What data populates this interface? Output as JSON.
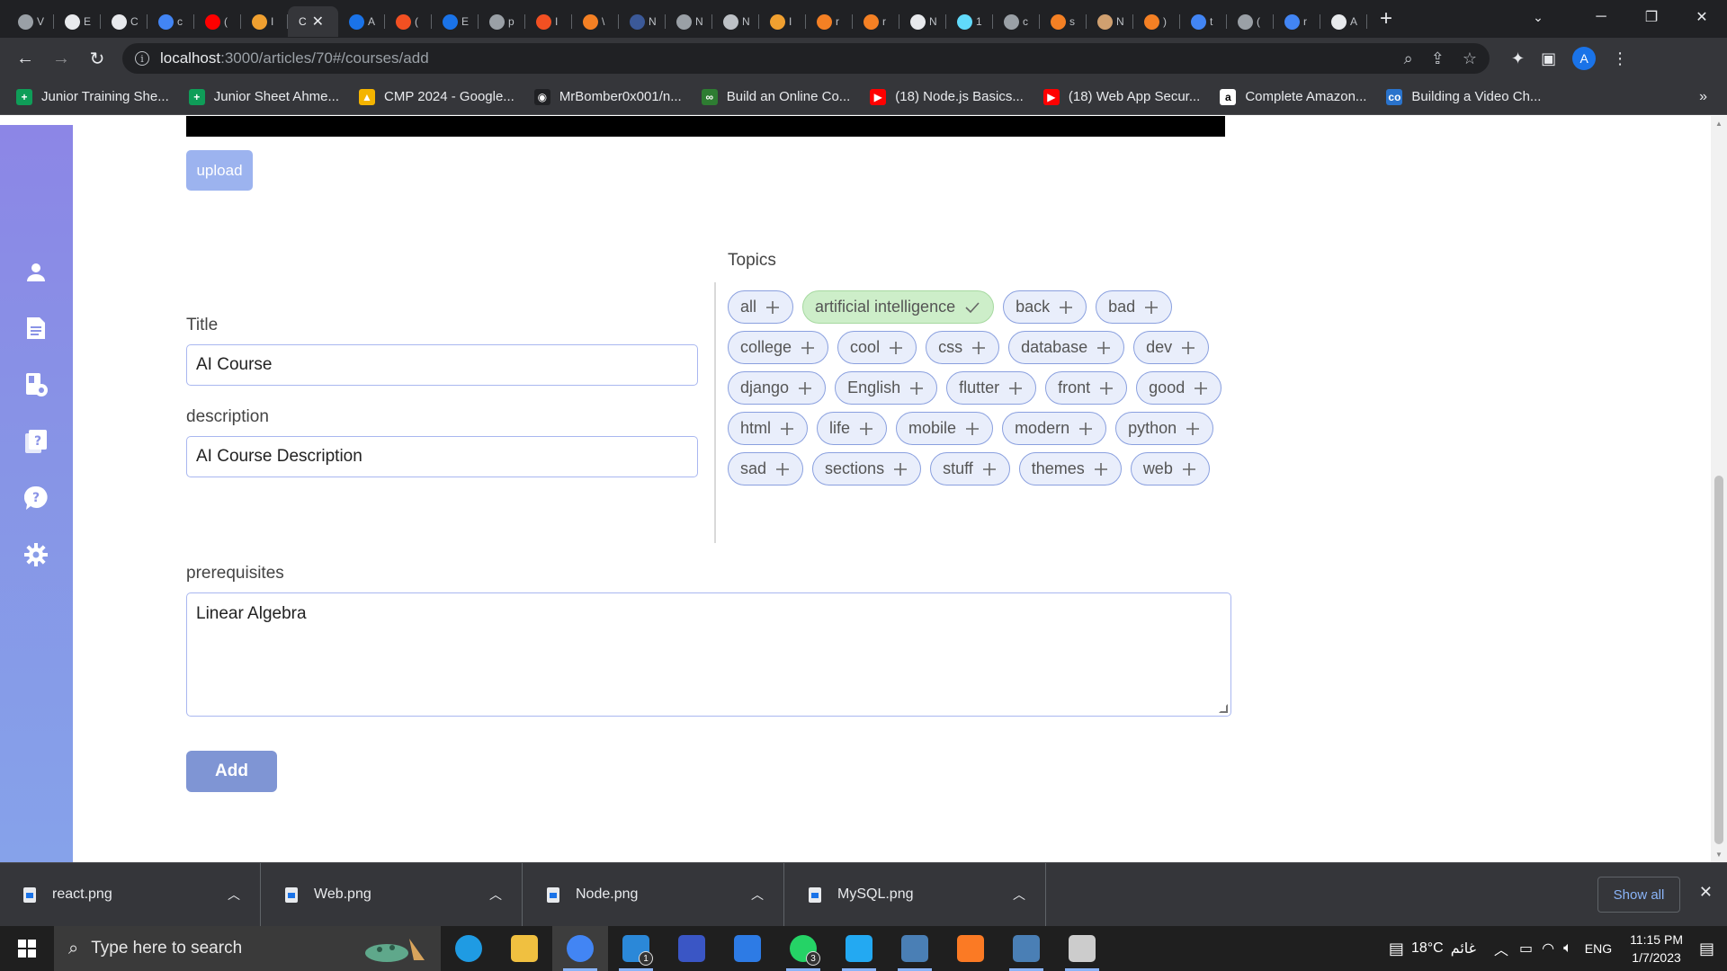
{
  "browser": {
    "tabs": [
      {
        "letter": "V",
        "color": "#9aa0a6"
      },
      {
        "letter": "E",
        "color": "#e8eaed"
      },
      {
        "letter": "C",
        "color": "#e8eaed"
      },
      {
        "letter": "c",
        "color": "#4285f4"
      },
      {
        "letter": "(",
        "color": "#ff0000"
      },
      {
        "letter": "I",
        "color": "#f0a030"
      },
      {
        "letter": "A",
        "color": "#1a73e8"
      },
      {
        "letter": "(",
        "color": "#f25022"
      },
      {
        "letter": "E",
        "color": "#1a73e8"
      },
      {
        "letter": "p",
        "color": "#9aa0a6"
      },
      {
        "letter": "I",
        "color": "#f25022"
      },
      {
        "letter": "\\",
        "color": "#f48024"
      },
      {
        "letter": "N",
        "color": "#3b5998"
      },
      {
        "letter": "N",
        "color": "#9aa0a6"
      },
      {
        "letter": "N",
        "color": "#bdc1c6"
      },
      {
        "letter": "I",
        "color": "#f0a030"
      },
      {
        "letter": "r",
        "color": "#f48024"
      },
      {
        "letter": "r",
        "color": "#f48024"
      },
      {
        "letter": "N",
        "color": "#e8eaed"
      },
      {
        "letter": "1",
        "color": "#61dafb"
      },
      {
        "letter": "c",
        "color": "#9aa0a6"
      },
      {
        "letter": "s",
        "color": "#f48024"
      },
      {
        "letter": "N",
        "color": "#d0a070"
      },
      {
        "letter": ")",
        "color": "#f48024"
      },
      {
        "letter": "t",
        "color": "#4285f4"
      },
      {
        "letter": "(",
        "color": "#9aa0a6"
      },
      {
        "letter": "r",
        "color": "#4285f4"
      },
      {
        "letter": "A",
        "color": "#e8eaed"
      }
    ],
    "active_tab": {
      "letter": "C",
      "close": "✕"
    },
    "new_tab_symbol": "+",
    "url": {
      "host": "localhost",
      "path": ":3000/articles/70#/courses/add"
    },
    "profile_initial": "A",
    "bookmarks": [
      {
        "label": "Junior Training She...",
        "icon": "sheets-icon",
        "color": "#0f9d58",
        "glyph": "+"
      },
      {
        "label": "Junior Sheet Ahme...",
        "icon": "sheets-icon",
        "color": "#0f9d58",
        "glyph": "+"
      },
      {
        "label": "CMP 2024 - Google...",
        "icon": "drive-icon",
        "color": "#f4b400",
        "glyph": "▲"
      },
      {
        "label": "MrBomber0x001/n...",
        "icon": "github-icon",
        "color": "#202124",
        "glyph": "◉"
      },
      {
        "label": "Build an Online Co...",
        "icon": "link-icon",
        "color": "#2e7d32",
        "glyph": "∞"
      },
      {
        "label": "(18) Node.js Basics...",
        "icon": "youtube-icon",
        "color": "#ff0000",
        "glyph": "▶"
      },
      {
        "label": "(18) Web App Secur...",
        "icon": "youtube-icon",
        "color": "#ff0000",
        "glyph": "▶"
      },
      {
        "label": "Complete Amazon...",
        "icon": "amazon-icon",
        "color": "#ffffff",
        "glyph": "a"
      },
      {
        "label": "Building a Video Ch...",
        "icon": "coursera-icon",
        "color": "#2a73cc",
        "glyph": "co"
      }
    ],
    "bookmarks_more": "»"
  },
  "page": {
    "upload_label": "upload",
    "title_label": "Title",
    "title_value": "AI Course",
    "description_label": "description",
    "description_value": "AI Course Description",
    "topics_label": "Topics",
    "topics": [
      {
        "name": "all",
        "selected": false
      },
      {
        "name": "artificial intelligence",
        "selected": true
      },
      {
        "name": "back",
        "selected": false
      },
      {
        "name": "bad",
        "selected": false
      },
      {
        "name": "college",
        "selected": false
      },
      {
        "name": "cool",
        "selected": false
      },
      {
        "name": "css",
        "selected": false
      },
      {
        "name": "database",
        "selected": false
      },
      {
        "name": "dev",
        "selected": false
      },
      {
        "name": "django",
        "selected": false
      },
      {
        "name": "English",
        "selected": false
      },
      {
        "name": "flutter",
        "selected": false
      },
      {
        "name": "front",
        "selected": false
      },
      {
        "name": "good",
        "selected": false
      },
      {
        "name": "html",
        "selected": false
      },
      {
        "name": "life",
        "selected": false
      },
      {
        "name": "mobile",
        "selected": false
      },
      {
        "name": "modern",
        "selected": false
      },
      {
        "name": "python",
        "selected": false
      },
      {
        "name": "sad",
        "selected": false
      },
      {
        "name": "sections",
        "selected": false
      },
      {
        "name": "stuff",
        "selected": false
      },
      {
        "name": "themes",
        "selected": false
      },
      {
        "name": "web",
        "selected": false
      }
    ],
    "prerequisites_label": "prerequisites",
    "prerequisites_value": "Linear Algebra",
    "add_label": "Add"
  },
  "sidebar": {
    "items": [
      {
        "name": "profile",
        "icon": "user-icon"
      },
      {
        "name": "articles",
        "icon": "document-icon"
      },
      {
        "name": "courses",
        "icon": "book-gear-icon"
      },
      {
        "name": "questions",
        "icon": "question-book-icon"
      },
      {
        "name": "help",
        "icon": "help-icon"
      },
      {
        "name": "settings",
        "icon": "gear-icon"
      }
    ]
  },
  "downloads": {
    "items": [
      {
        "name": "react.png"
      },
      {
        "name": "Web.png"
      },
      {
        "name": "Node.png"
      },
      {
        "name": "MySQL.png"
      }
    ],
    "show_all": "Show all",
    "close": "✕"
  },
  "taskbar": {
    "search_placeholder": "Type here to search",
    "apps": [
      {
        "icon": "edge-icon",
        "color": "#1f9be3",
        "open": false
      },
      {
        "icon": "file-explorer-icon",
        "color": "#f0c040",
        "open": false
      },
      {
        "icon": "chrome-icon",
        "color": "#4285f4",
        "open": true,
        "active": true
      },
      {
        "icon": "mail-icon",
        "color": "#2b88d8",
        "open": true,
        "badge": "1"
      },
      {
        "icon": "mysql-workbench-icon",
        "color": "#3a56c5",
        "open": false
      },
      {
        "icon": "todo-icon",
        "color": "#2d7be5",
        "open": false
      },
      {
        "icon": "whatsapp-icon",
        "color": "#25d366",
        "open": true,
        "badge": "3"
      },
      {
        "icon": "vscode-icon",
        "color": "#23a9f2",
        "open": true
      },
      {
        "icon": "workbench-icon",
        "color": "#4a7fb5",
        "open": true
      },
      {
        "icon": "xampp-icon",
        "color": "#fb7a24",
        "open": false
      },
      {
        "icon": "workbench-icon",
        "color": "#4a7fb5",
        "open": true
      },
      {
        "icon": "terminal-icon",
        "color": "#cccccc",
        "open": true
      }
    ],
    "weather_temp": "18°C",
    "weather_text": "غائم",
    "language": "ENG",
    "time": "11:15 PM",
    "date": "1/7/2023"
  }
}
